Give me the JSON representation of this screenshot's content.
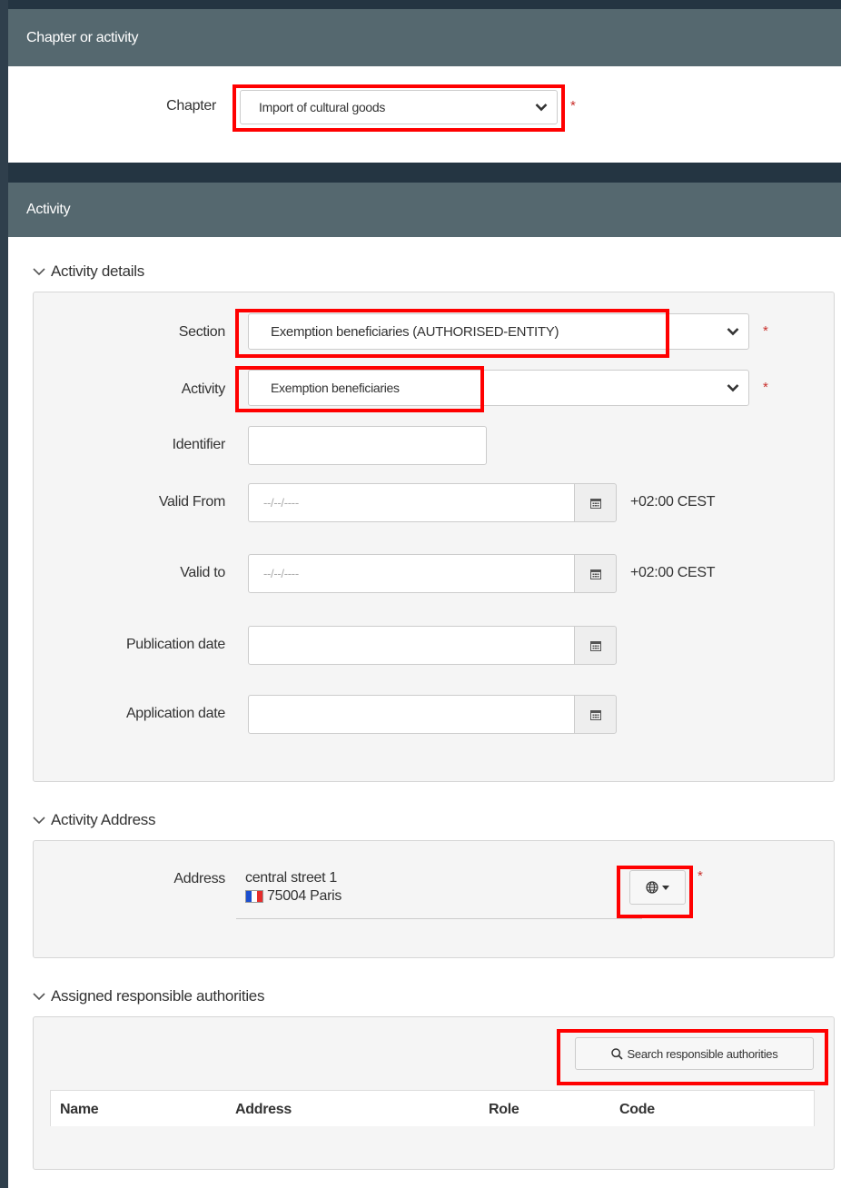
{
  "chapter_panel": {
    "title": "Chapter or activity",
    "chapter_label": "Chapter",
    "chapter_value": "Import of cultural goods",
    "required_mark": "*"
  },
  "activity_panel": {
    "title": "Activity",
    "details": {
      "title": "Activity details",
      "section_label": "Section",
      "section_value": "Exemption beneficiaries (AUTHORISED-ENTITY)",
      "activity_label": "Activity",
      "activity_value": "Exemption beneficiaries",
      "identifier_label": "Identifier",
      "identifier_value": "",
      "valid_from_label": "Valid From",
      "valid_from_placeholder": "--/--/----",
      "valid_to_label": "Valid to",
      "valid_to_placeholder": "--/--/----",
      "publication_label": "Publication date",
      "application_label": "Application date",
      "timezone": "+02:00 CEST",
      "required_mark": "*"
    },
    "address": {
      "title": "Activity Address",
      "label": "Address",
      "street": "central street 1",
      "city": "75004 Paris",
      "required_mark": "*"
    },
    "authorities": {
      "title": "Assigned responsible authorities",
      "search_button": "Search responsible authorities",
      "columns": [
        "Name",
        "Address",
        "Role",
        "Code"
      ]
    }
  },
  "colors": {
    "panel_header": "#55686f",
    "dark_strip": "#243542",
    "highlight": "#ff0000",
    "required": "#c9302c"
  }
}
